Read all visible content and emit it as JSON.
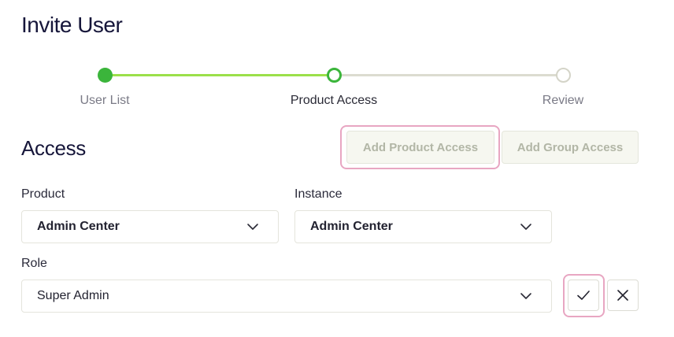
{
  "page": {
    "title": "Invite User"
  },
  "stepper": {
    "steps": [
      {
        "label": "User List",
        "status": "complete"
      },
      {
        "label": "Product Access",
        "status": "current"
      },
      {
        "label": "Review",
        "status": "upcoming"
      }
    ],
    "colors": {
      "complete": "#3bb53b",
      "progress": "#9be04a",
      "upcoming": "#dcdcd0"
    }
  },
  "access": {
    "title": "Access",
    "add_product_label": "Add Product Access",
    "add_group_label": "Add Group Access"
  },
  "form": {
    "product": {
      "label": "Product",
      "value": "Admin Center"
    },
    "instance": {
      "label": "Instance",
      "value": "Admin Center"
    },
    "role": {
      "label": "Role",
      "value": "Super Admin"
    }
  },
  "icons": {
    "dropdown": "chevron-down-icon",
    "confirm": "check-icon",
    "cancel": "close-icon"
  },
  "highlight_color": "#e8a6c2"
}
